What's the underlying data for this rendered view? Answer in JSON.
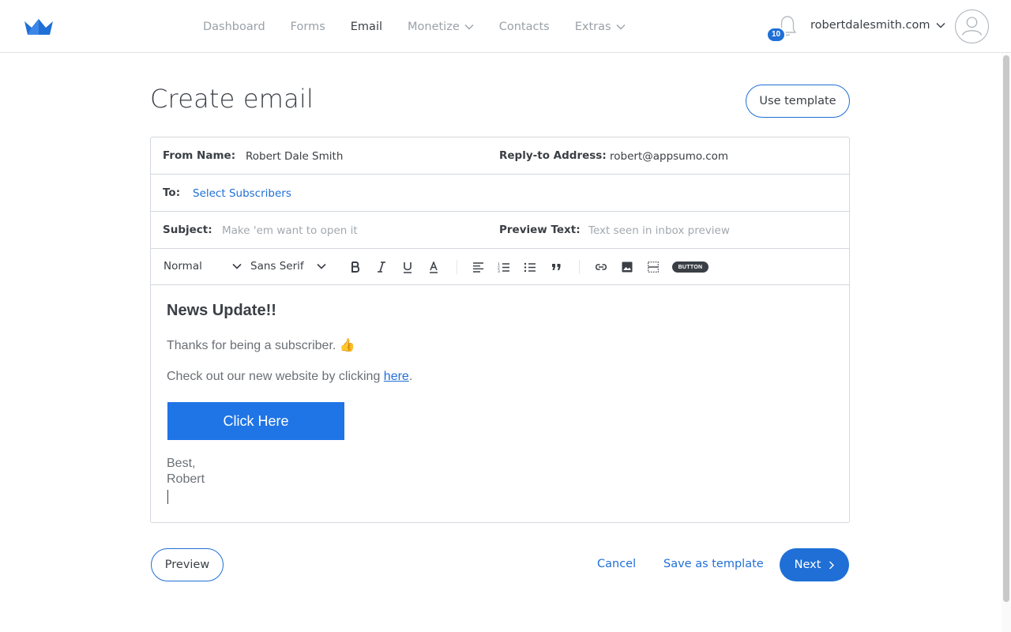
{
  "nav": {
    "items": [
      {
        "label": "Dashboard",
        "active": false,
        "dropdown": false
      },
      {
        "label": "Forms",
        "active": false,
        "dropdown": false
      },
      {
        "label": "Email",
        "active": true,
        "dropdown": false
      },
      {
        "label": "Monetize",
        "active": false,
        "dropdown": true
      },
      {
        "label": "Contacts",
        "active": false,
        "dropdown": false
      },
      {
        "label": "Extras",
        "active": false,
        "dropdown": true
      }
    ],
    "notification_count": "10",
    "account_name": "robertdalesmith.com"
  },
  "page": {
    "title": "Create email",
    "use_template_label": "Use template"
  },
  "form": {
    "from_name_label": "From Name:",
    "from_name_value": "Robert Dale Smith",
    "reply_to_label": "Reply-to Address:",
    "reply_to_value": "robert@appsumo.com",
    "to_label": "To:",
    "to_link": "Select Subscribers",
    "subject_label": "Subject:",
    "subject_placeholder": "Make 'em want to open it",
    "preview_text_label": "Preview Text:",
    "preview_text_placeholder": "Text seen in inbox preview"
  },
  "toolbar": {
    "format_value": "Normal",
    "font_value": "Sans Serif",
    "button_pill_label": "BUTTON"
  },
  "editor": {
    "heading": "News Update!!",
    "line1": "Thanks for being a subscriber. 👍",
    "line2_prefix": "Check out our new website by clicking ",
    "line2_link": "here",
    "line2_suffix": ".",
    "cta_label": "Click Here",
    "sign_off": "Best,",
    "signature": "Robert"
  },
  "actions": {
    "preview_label": "Preview",
    "cancel_label": "Cancel",
    "save_template_label": "Save as template",
    "next_label": "Next"
  },
  "colors": {
    "accent": "#1f6fd6",
    "cta_button": "#1f74e6",
    "border": "#d3d7dc"
  }
}
